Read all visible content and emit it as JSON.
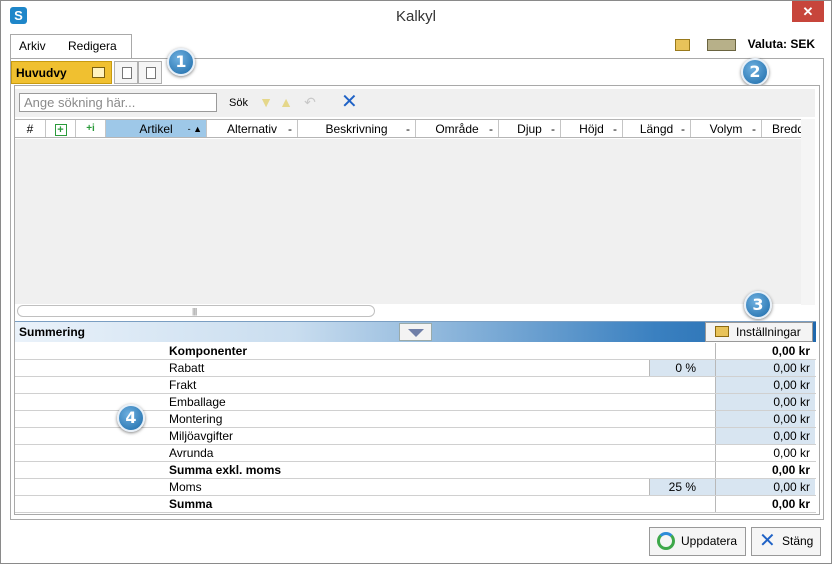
{
  "window": {
    "title": "Kalkyl",
    "close_glyph": "✕"
  },
  "menu": {
    "items": [
      "Arkiv",
      "Redigera"
    ]
  },
  "currency": {
    "label": "Valuta: SEK"
  },
  "views": {
    "active_tab": "Huvudvy"
  },
  "badges": [
    "1",
    "2",
    "3",
    "4"
  ],
  "search": {
    "placeholder": "Ange sökning här...",
    "button_label": "Sök"
  },
  "grid": {
    "columns": [
      "#",
      "+",
      "+i",
      "Artikel",
      "Alternativ",
      "Beskrivning",
      "Område",
      "Djup",
      "Höjd",
      "Längd",
      "Volym",
      "Bredd"
    ],
    "sorted_column": "Artikel",
    "rows": []
  },
  "summary": {
    "title": "Summering",
    "settings_label": "Inställningar",
    "rows": [
      {
        "label": "Komponenter",
        "value": "0,00 kr",
        "bold": true,
        "pct": null,
        "shaded": false
      },
      {
        "label": "Rabatt",
        "value": "0,00 kr",
        "bold": false,
        "pct": "0 %",
        "shaded": true
      },
      {
        "label": "Frakt",
        "value": "0,00 kr",
        "bold": false,
        "pct": null,
        "shaded": true
      },
      {
        "label": "Emballage",
        "value": "0,00 kr",
        "bold": false,
        "pct": null,
        "shaded": true
      },
      {
        "label": "Montering",
        "value": "0,00 kr",
        "bold": false,
        "pct": null,
        "shaded": true
      },
      {
        "label": "Miljöavgifter",
        "value": "0,00 kr",
        "bold": false,
        "pct": null,
        "shaded": true
      },
      {
        "label": "Avrunda",
        "value": "0,00 kr",
        "bold": false,
        "pct": null,
        "shaded": false
      },
      {
        "label": "Summa exkl. moms",
        "value": "0,00 kr",
        "bold": true,
        "pct": null,
        "shaded": false
      },
      {
        "label": "Moms",
        "value": "0,00 kr",
        "bold": false,
        "pct": "25 %",
        "shaded": true
      },
      {
        "label": "Summa",
        "value": "0,00 kr",
        "bold": true,
        "pct": null,
        "shaded": false
      }
    ]
  },
  "buttons": {
    "update": "Uppdatera",
    "close": "Stäng"
  },
  "colors": {
    "accent": "#1e86c9",
    "active_tab": "#f0c030",
    "close": "#c7453b"
  }
}
